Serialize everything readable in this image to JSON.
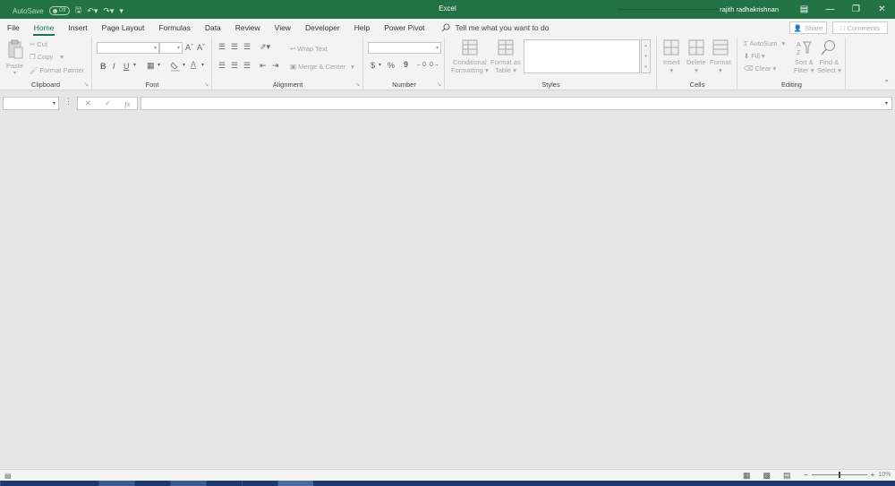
{
  "titlebar": {
    "autosave_label": "AutoSave",
    "autosave_state": "Off",
    "app_title": "Excel",
    "user_name": "rajith radhakrishnan",
    "bg_color": "#217346"
  },
  "tabs": [
    {
      "label": "File"
    },
    {
      "label": "Home",
      "active": true
    },
    {
      "label": "Insert"
    },
    {
      "label": "Page Layout"
    },
    {
      "label": "Formulas"
    },
    {
      "label": "Data"
    },
    {
      "label": "Review"
    },
    {
      "label": "View"
    },
    {
      "label": "Developer"
    },
    {
      "label": "Help"
    },
    {
      "label": "Power Pivot"
    }
  ],
  "tell_me": "Tell me what you want to do",
  "share_label": "Share",
  "comments_label": "Comments",
  "clipboard": {
    "group": "Clipboard",
    "paste": "Paste",
    "cut": "Cut",
    "copy": "Copy",
    "format_painter": "Format Painter"
  },
  "font": {
    "group": "Font",
    "bold": "B",
    "italic": "I",
    "underline": "U"
  },
  "alignment": {
    "group": "Alignment",
    "wrap_text": "Wrap Text",
    "merge_center": "Merge & Center"
  },
  "number": {
    "group": "Number",
    "currency": "$",
    "percent": "%",
    "comma": "9"
  },
  "styles": {
    "group": "Styles",
    "conditional_formatting_1": "Conditional",
    "conditional_formatting_2": "Formatting",
    "format_as_table_1": "Format as",
    "format_as_table_2": "Table"
  },
  "cells": {
    "group": "Cells",
    "insert": "Insert",
    "delete": "Delete",
    "format": "Format"
  },
  "editing": {
    "group": "Editing",
    "autosum": "AutoSum",
    "fill": "Fill",
    "clear": "Clear",
    "sort_filter_1": "Sort &",
    "sort_filter_2": "Filter",
    "find_select_1": "Find &",
    "find_select_2": "Select"
  },
  "formula_bar": {
    "cancel": "✕",
    "enter": "✓",
    "fx": "fx"
  },
  "status": {
    "zoom": "10%",
    "zoom_level": 0.1
  }
}
